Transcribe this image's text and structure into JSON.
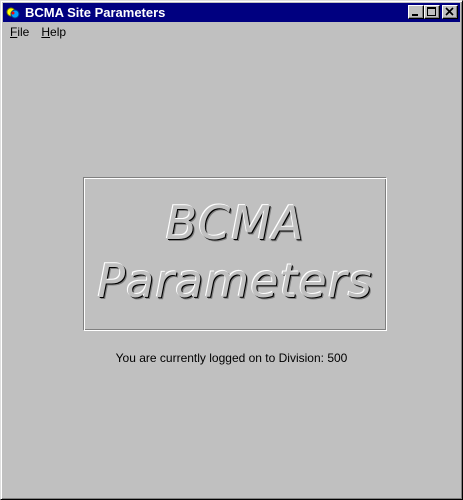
{
  "window": {
    "title": "BCMA Site Parameters",
    "icon": "bcma-app-icon"
  },
  "menu": {
    "items": [
      {
        "label_ul": "F",
        "label_rest": "ile"
      },
      {
        "label_ul": "H",
        "label_rest": "elp"
      }
    ]
  },
  "banner": {
    "line1": "BCMA",
    "line2": "Parameters"
  },
  "status": {
    "text": "You are currently logged on to Division: 500"
  },
  "colors": {
    "titlebar": "#000080",
    "face": "#c0c0c0"
  }
}
